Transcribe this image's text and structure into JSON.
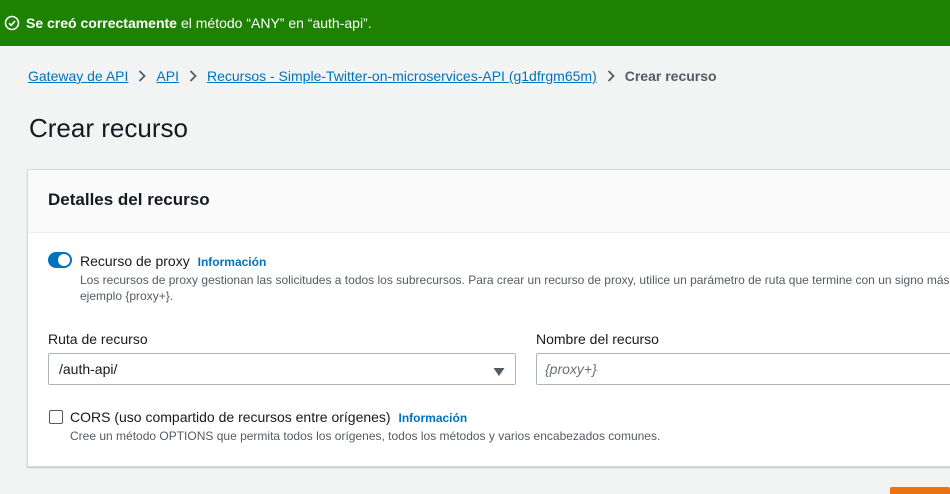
{
  "flash": {
    "bold": "Se creó correctamente",
    "rest": "el método “ANY” en “auth-api”.",
    "color": "#1d8102"
  },
  "breadcrumb": {
    "items": [
      "Gateway de API",
      "API",
      "Recursos - Simple-Twitter-on-microservices-API (g1dfrgm65m)"
    ],
    "current": "Crear recurso"
  },
  "page": {
    "title": "Crear recurso"
  },
  "panel": {
    "title": "Detalles del recurso",
    "proxy": {
      "label": "Recurso de proxy",
      "info": "Información",
      "description_line1": "Los recursos de proxy gestionan las solicitudes a todos los subrecursos. Para crear un recurso de proxy, utilice un parámetro de ruta que termine con un signo más",
      "description_line2": "ejemplo {proxy+}.",
      "enabled": true
    },
    "resource_path": {
      "label": "Ruta de recurso",
      "value": "/auth-api/"
    },
    "resource_name": {
      "label": "Nombre del recurso",
      "placeholder": "{proxy+}"
    },
    "cors": {
      "label": "CORS (uso compartido de recursos entre orígenes)",
      "info": "Información",
      "description": "Cree un método OPTIONS que permita todos los orígenes, todos los métodos y varios encabezados comunes.",
      "checked": false
    }
  },
  "colors": {
    "link": "#0073bb",
    "accent": "#ec7211"
  }
}
